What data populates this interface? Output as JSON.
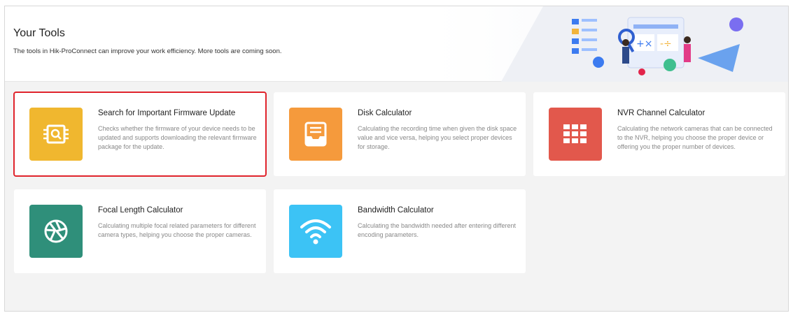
{
  "header": {
    "title": "Your Tools",
    "subtitle": "The tools in Hik-ProConnect can improve your work efficiency. More tools are coming soon."
  },
  "tools": [
    {
      "title": "Search for Important Firmware Update",
      "description": "Checks whether the firmware of your device needs to be updated and supports downloading the relevant firmware package for the update.",
      "icon": "firmware-search-icon",
      "color": "#f0b72f",
      "selected": true
    },
    {
      "title": "Disk Calculator",
      "description": "Calculating the recording time when given the disk space value and vice versa, helping you select proper devices for storage.",
      "icon": "disk-tray-icon",
      "color": "#f59a3c"
    },
    {
      "title": "NVR Channel Calculator",
      "description": "Calculating the network cameras that can be connected to the NVR, helping you choose the proper device or offering you the proper number of devices.",
      "icon": "grid-icon",
      "color": "#e2584c"
    },
    {
      "title": "Focal Length Calculator",
      "description": "Calculating multiple focal related parameters for different camera types, helping you choose the proper cameras.",
      "icon": "aperture-icon",
      "color": "#2f8f7a"
    },
    {
      "title": "Bandwidth Calculator",
      "description": "Calculating the bandwidth needed after entering different encoding parameters.",
      "icon": "wifi-icon",
      "color": "#3cc3f5"
    }
  ],
  "colors": {
    "selection_border": "#e0242c",
    "background": "#f3f3f3"
  }
}
